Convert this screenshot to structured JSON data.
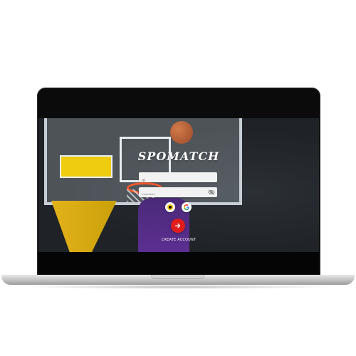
{
  "app": {
    "brand": "SPOMATCH"
  },
  "login": {
    "email_placeholder": "Id",
    "email_value": "",
    "password_placeholder": "********",
    "password_value": "",
    "submit_icon": "arrow-right-icon",
    "signup_text": "CREATE ACCOUNT"
  },
  "social": {
    "items": [
      {
        "name": "yellow-circle-icon"
      },
      {
        "name": "google-icon"
      }
    ]
  },
  "colors": {
    "accent": "#e01d1d",
    "field_bg": "#f2f2f2"
  }
}
